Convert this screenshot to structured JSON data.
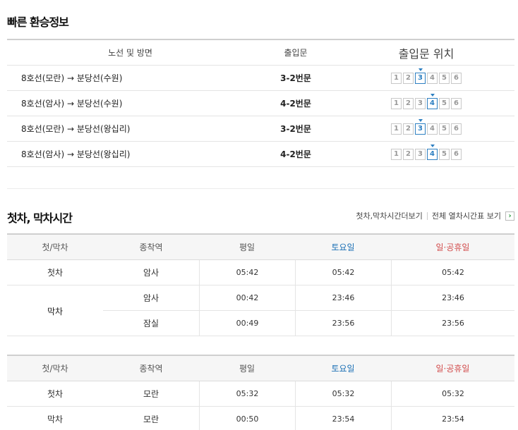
{
  "transfer": {
    "title": "빠른 환승정보",
    "headers": [
      "노선 및 방면",
      "출입문",
      "출입문 위치"
    ],
    "rows": [
      {
        "route": "8호선(모란) → 분당선(수원)",
        "door": "3-2번문",
        "active": 3
      },
      {
        "route": "8호선(암사) → 분당선(수원)",
        "door": "4-2번문",
        "active": 4
      },
      {
        "route": "8호선(모란) → 분당선(왕십리)",
        "door": "3-2번문",
        "active": 3
      },
      {
        "route": "8호선(암사) → 분당선(왕십리)",
        "door": "4-2번문",
        "active": 4
      }
    ],
    "door_numbers": [
      "1",
      "2",
      "3",
      "4",
      "5",
      "6"
    ],
    "active_color": "#2d7fc1"
  },
  "timetable": {
    "title": "첫차, 막차시간",
    "link_more": "첫차,막차시간더보기",
    "link_all": "전체 열차시간표 보기",
    "more_icon": "chevron-right-icon",
    "headers": [
      "첫/막차",
      "종착역",
      "평일",
      "토요일",
      "일·공휴일"
    ],
    "colors": {
      "saturday": "#1a6fb5",
      "holiday": "#d24a4a"
    },
    "table1": {
      "first": {
        "label": "첫차",
        "station": "암사",
        "weekday": "05:42",
        "sat": "05:42",
        "hol": "05:42"
      },
      "last_label": "막차",
      "last": [
        {
          "station": "암사",
          "weekday": "00:42",
          "sat": "23:46",
          "hol": "23:46"
        },
        {
          "station": "잠실",
          "weekday": "00:49",
          "sat": "23:56",
          "hol": "23:56"
        }
      ]
    },
    "table2": {
      "first": {
        "label": "첫차",
        "station": "모란",
        "weekday": "05:32",
        "sat": "05:32",
        "hol": "05:32"
      },
      "last": {
        "label": "막차",
        "station": "모란",
        "weekday": "00:50",
        "sat": "23:54",
        "hol": "23:54"
      }
    }
  }
}
